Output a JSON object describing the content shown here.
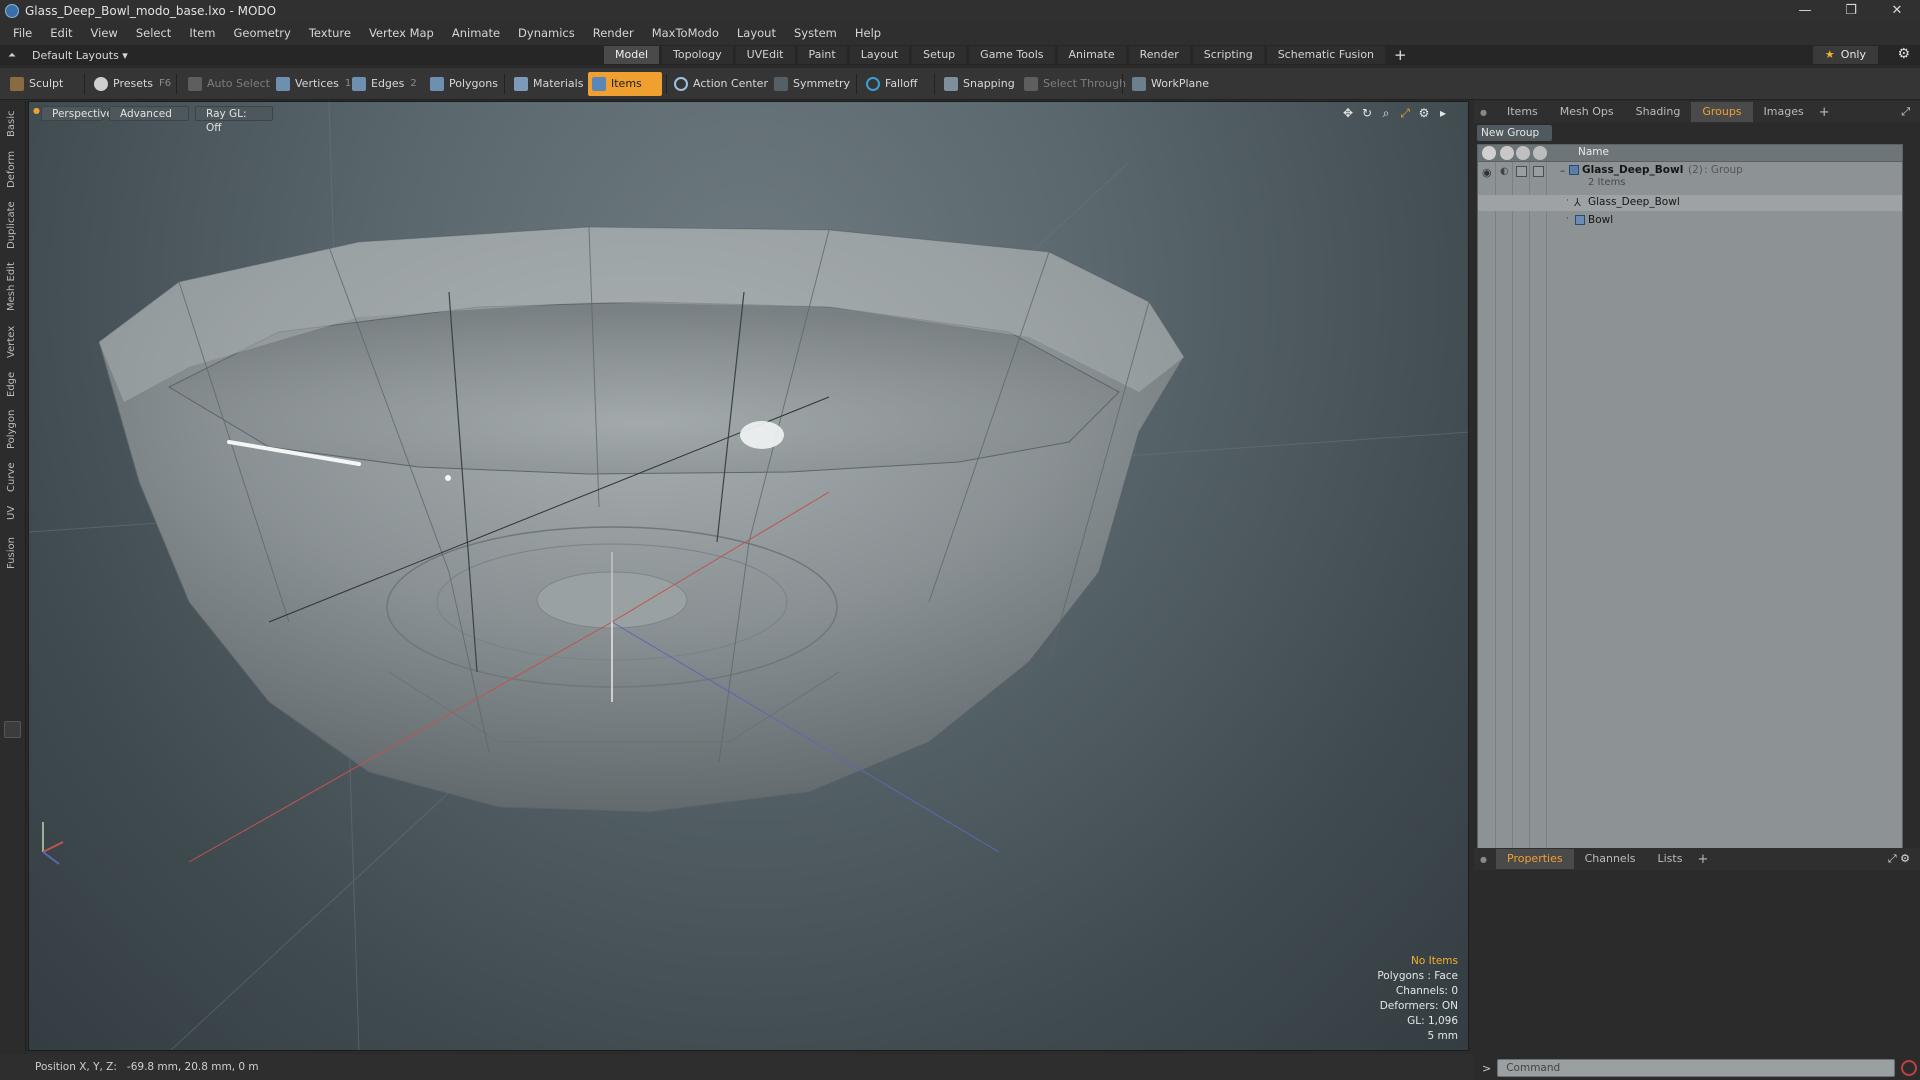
{
  "window": {
    "title": "Glass_Deep_Bowl_modo_base.lxo - MODO",
    "minimize": "—",
    "restore": "❐",
    "close": "✕"
  },
  "menus": [
    "File",
    "Edit",
    "View",
    "Select",
    "Item",
    "Geometry",
    "Texture",
    "Vertex Map",
    "Animate",
    "Dynamics",
    "Render",
    "MaxToModo",
    "Layout",
    "System",
    "Help"
  ],
  "layoutbar": {
    "layout_selector": "Default Layouts ▾",
    "tabs": [
      "Model",
      "Topology",
      "UVEdit",
      "Paint",
      "Layout",
      "Setup",
      "Game Tools",
      "Animate",
      "Render",
      "Scripting",
      "Schematic Fusion"
    ],
    "active_tab": "Model",
    "only_label": "Only"
  },
  "toolbar": {
    "sculpt": "Sculpt",
    "presets": "Presets",
    "presets_key": "F6",
    "auto_select": "Auto Select",
    "vertices": "Vertices",
    "vertices_key": "1",
    "edges": "Edges",
    "edges_key": "2",
    "polygons": "Polygons",
    "materials": "Materials",
    "items": "Items",
    "action_center": "Action Center",
    "symmetry": "Symmetry",
    "falloff": "Falloff",
    "snapping": "Snapping",
    "select_through": "Select Through",
    "workplane": "WorkPlane"
  },
  "left_tabs": [
    "Basic",
    "Deform",
    "Duplicate",
    "Mesh Edit",
    "Vertex",
    "Edge",
    "Polygon",
    "Curve",
    "UV",
    "Fusion"
  ],
  "viewport": {
    "perspective": "Perspective",
    "advanced": "Advanced",
    "raygl": "Ray GL: Off",
    "info": {
      "no_items": "No Items",
      "polygons": "Polygons : Face",
      "channels": "Channels: 0",
      "deformers": "Deformers: ON",
      "gl": "GL: 1,096",
      "scale": "5 mm"
    }
  },
  "status": {
    "label": "Position X, Y, Z:",
    "value": "-69.8 mm, 20.8 mm, 0 m"
  },
  "right_panel": {
    "top_tabs": [
      "Items",
      "Mesh Ops",
      "Shading",
      "Groups",
      "Images"
    ],
    "active_top_tab": "Groups",
    "new_group": "New Group",
    "name_header": "Name",
    "group": {
      "name": "Glass_Deep_Bowl",
      "count": "(2)",
      "type": ": Group",
      "items_label": "2 Items"
    },
    "children": [
      {
        "name": "Glass_Deep_Bowl",
        "icon": "mesh-icon"
      },
      {
        "name": "Bowl",
        "icon": "cube-icon"
      }
    ],
    "bottom_tabs": [
      "Properties",
      "Channels",
      "Lists"
    ],
    "active_bottom_tab": "Properties",
    "command_placeholder": "Command"
  },
  "colors": {
    "accent": "#f0a030",
    "viewport_bg": "#5a676c",
    "list_bg": "#8d9294"
  }
}
